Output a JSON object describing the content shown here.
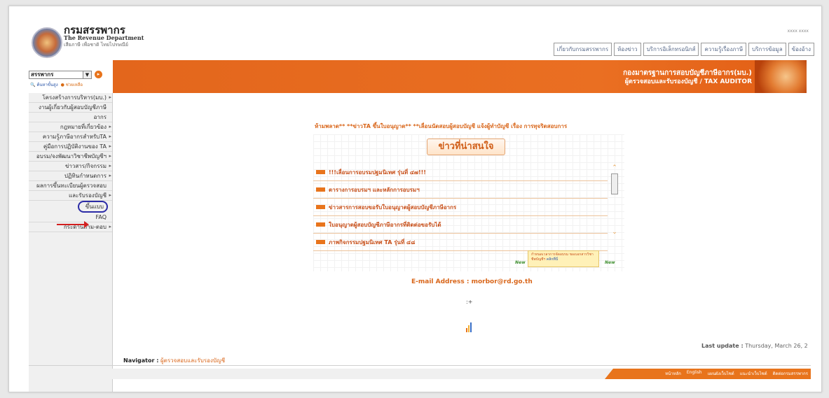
{
  "header": {
    "logo": "revenue-department-seal",
    "brand_th": "กรมสรรพากร",
    "brand_en": "The Revenue Department",
    "slogan": "เสียภาษี เพื่อชาติ ไทยไปรษณีย์",
    "small_right": "xxxx xxxx"
  },
  "topnav": [
    "เกี่ยวกับกรมสรรพากร",
    "ห้องข่าว",
    "บริการอิเล็กทรอนิกส์",
    "ความรู้เรื่องภาษี",
    "บริการข้อมูล",
    "ข้องอ้าง"
  ],
  "banner": {
    "line1": "กองมาตรฐานการสอบบัญชีภาษีอากร(มบ.)",
    "line2": "ผู้ตรวจสอบและรับรองบัญชี / TAX AUDITOR"
  },
  "search": {
    "select_value": "สรรพากร",
    "go_icon": "go-arrow-icon",
    "search_link": "ค้นหาขั้นสูง",
    "help_link": "ช่วยเหลือ"
  },
  "sidebar": {
    "items": [
      "โครงสร้างการบริหาร(มบ.)",
      "งานผู้เกี่ยวกับผู้สอบบัญชีภาษี",
      "อากร",
      "กฎหมายที่เกี่ยวข้อง",
      "ความรู้ภาษีอากรสำหรับTA",
      "คู่มือการปฏิบัติงานของ TA",
      "อบรม/จงพัฒนาวิชาชีพบัญชีฯ",
      "ข่าวสาร/กิจกรรม",
      "ปฏิทินกำหนดการ",
      "ผลการขึ้นทะเบียนผู้ตรวจสอบ",
      "และรับรองบัญชี",
      "ขึ้นแบบ",
      "FAQ",
      "กระดานถาม-ตอบ"
    ]
  },
  "main": {
    "ticker": "ห้ามพลาด** **ข่าวTA ขึ้นใบอนุญาต** **เลื่อนนัดสอบผู้สอบบัญชี แจ้งผู้ทำบัญชี เรื่อง การทุจริตสอบการ",
    "news_title": "ข่าวที่น่าสนใจ",
    "news": [
      "!!!เลื่อนการอบรมปฐมนิเทศ รุ่นที่ ๔๗!!!",
      "ตารางการอบรมฯ และหลักการอบรมฯ",
      "ข่าวสารการสอบขอรับใบอนุญาตผู้สอบบัญชีภาษีอากร",
      "ใบอนุญาตผู้สอบบัญชีภาษีอากรที่ติดต่อขอรับได้",
      "ภาพกิจกรรมปฐมนิเทศ TA รุ่นที่ ๔๘"
    ],
    "promo_text": "กำหนดเวลาการจัดอบรม ของเอกสารวิชาชีพบัญชีฯ",
    "promo_more": "คลิกที่นี่",
    "new_badge": "New",
    "email": "E-mail Address : morbor@rd.go.th",
    "plus": ":+",
    "last_update_label": "Last update :",
    "last_update_value": "Thursday, March 26, 2"
  },
  "navigator": {
    "label": "Navigator :",
    "path": "ผู้ตรวจสอบและรับรองบัญชี"
  },
  "footer": {
    "links": [
      "หน้าหลัก",
      "English",
      "แผนผังเว็บไซต์",
      "แนะนำเว็บไซต์",
      "ติดต่อกรมสรรพากร"
    ]
  },
  "colors": {
    "accent": "#e8741c",
    "annotation_circle": "#2b2ba6",
    "annotation_arrow": "#d21f1f"
  }
}
